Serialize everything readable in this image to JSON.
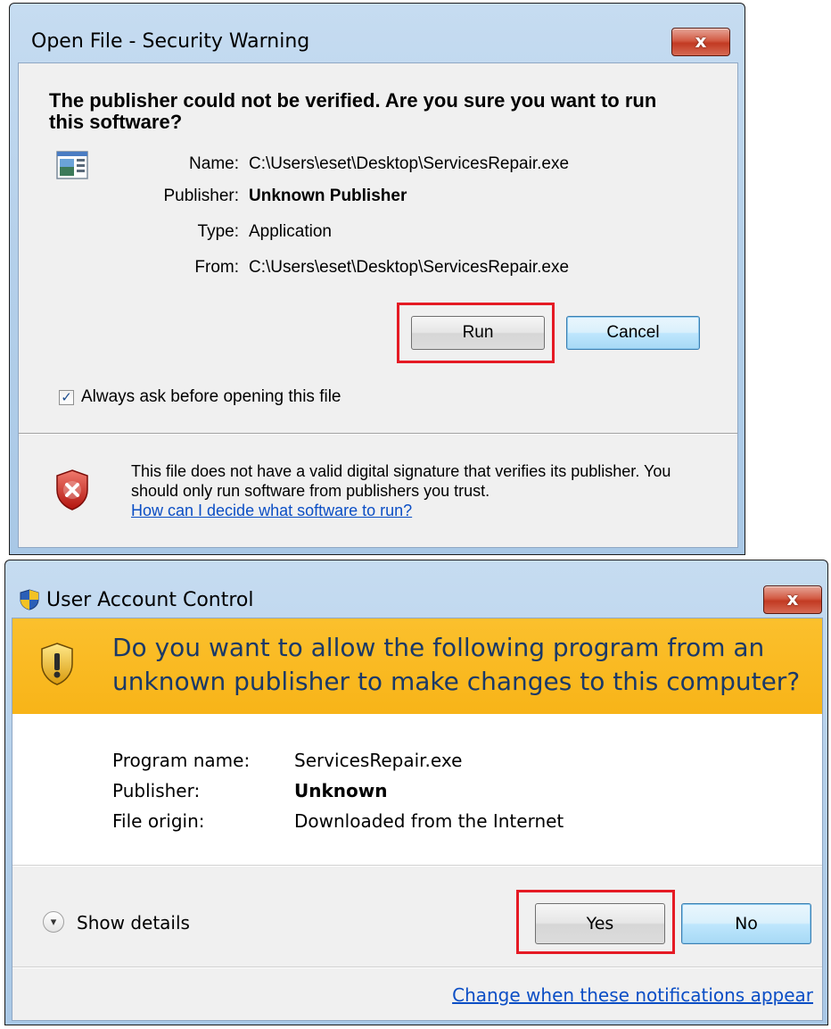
{
  "security_warning": {
    "title": "Open File - Security Warning",
    "close_label": "x",
    "headline": "The publisher could not be verified.  Are you sure you want to run this software?",
    "fields": [
      {
        "label": "Name:",
        "value": "C:\\Users\\eset\\Desktop\\ServicesRepair.exe",
        "bold": false
      },
      {
        "label": "Publisher:",
        "value": "Unknown Publisher",
        "bold": true
      },
      {
        "label": "Type:",
        "value": "Application",
        "bold": false
      },
      {
        "label": "From:",
        "value": "C:\\Users\\eset\\Desktop\\ServicesRepair.exe",
        "bold": false
      }
    ],
    "run_label": "Run",
    "cancel_label": "Cancel",
    "checkbox_label": "Always ask before opening this file",
    "checkbox_checked": true,
    "warning_text": "This file does not have a valid digital signature that verifies its publisher.  You should only run software from publishers you trust.",
    "help_link": "How can I decide what software to run?"
  },
  "uac": {
    "title": "User Account Control",
    "close_label": "x",
    "question": "Do you want to allow the following program from an unknown publisher to make changes to this computer?",
    "fields": [
      {
        "label": "Program name:",
        "value": "ServicesRepair.exe",
        "bold": false
      },
      {
        "label": "Publisher:",
        "value": "Unknown",
        "bold": true
      },
      {
        "label": "File origin:",
        "value": "Downloaded from the Internet",
        "bold": false
      }
    ],
    "show_details_label": "Show details",
    "yes_label": "Yes",
    "no_label": "No",
    "settings_link": "Change when these notifications appear"
  },
  "colors": {
    "highlight": "#e51a24",
    "uac_banner": "#f8b418",
    "link": "#0b4ec5"
  }
}
